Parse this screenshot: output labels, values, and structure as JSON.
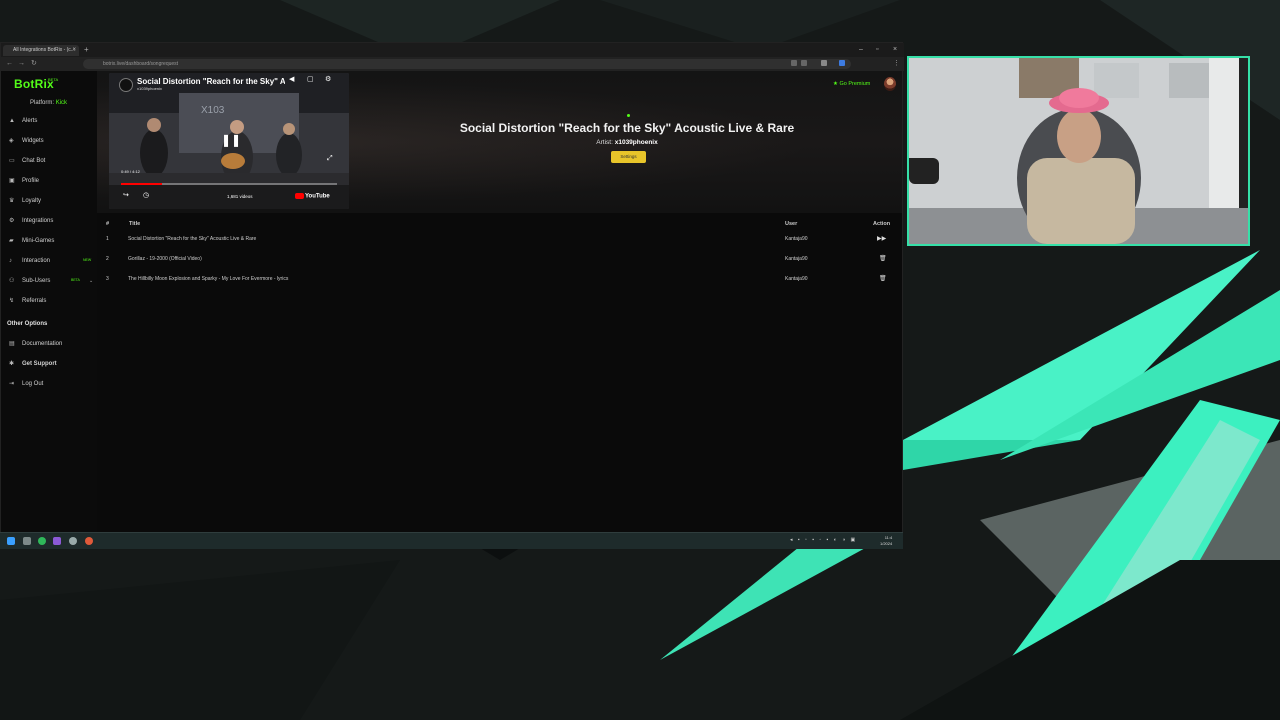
{
  "browser": {
    "tab_title": "All Integrations BotRix - (c...",
    "url": "botrix.live/dashboard/songrequest"
  },
  "sidebar": {
    "logo": "BotRix",
    "logo_beta": "BETA",
    "platform_label": "Platform:",
    "platform_value": "Kick",
    "items": [
      {
        "label": "Alerts",
        "icon": "bell-icon"
      },
      {
        "label": "Widgets",
        "icon": "widget-icon"
      },
      {
        "label": "Chat Bot",
        "icon": "chat-icon"
      },
      {
        "label": "Profile",
        "icon": "profile-icon"
      },
      {
        "label": "Loyalty",
        "icon": "trophy-icon"
      },
      {
        "label": "Integrations",
        "icon": "plug-icon"
      },
      {
        "label": "Mini-Games",
        "icon": "gamepad-icon"
      },
      {
        "label": "Interaction",
        "icon": "music-icon",
        "badge": "NEW"
      },
      {
        "label": "Sub-Users",
        "icon": "users-icon",
        "badge": "BETA"
      },
      {
        "label": "Referrals",
        "icon": "referral-icon"
      }
    ],
    "other_title": "Other Options",
    "other_items": [
      {
        "label": "Documentation",
        "icon": "doc-icon"
      },
      {
        "label": "Get Support",
        "icon": "support-icon"
      },
      {
        "label": "Log Out",
        "icon": "logout-icon"
      }
    ]
  },
  "header": {
    "go_premium": "Go Premium"
  },
  "player": {
    "video_title": "Social Distortion \"Reach for the Sky\" A",
    "video_channel": "x1039phoenix",
    "video_time": "0:49 / 4:12",
    "video_progress": 0.19,
    "video_views": "1,681 videos",
    "youtube_label": "YouTube",
    "now_title": "Social Distortion \"Reach for the Sky\" Acoustic Live & Rare",
    "artist_label": "Artist:",
    "artist_value": "x1039phoenix",
    "settings_label": "Settings"
  },
  "queue": {
    "headers": {
      "num": "#",
      "title": "Title",
      "user": "User",
      "action": "Action"
    },
    "rows": [
      {
        "num": "1",
        "title": "Social Distortion \"Reach for the Sky\" Acoustic Live & Rare",
        "user": "Kantaja90",
        "action": "play-next-icon"
      },
      {
        "num": "2",
        "title": "Gorillaz - 19-2000 (Official Video)",
        "user": "Kantaja90",
        "action": "trash-icon"
      },
      {
        "num": "3",
        "title": "The Hillbilly Moon Explosion and Sparky - My Love For Evermore - lyrics",
        "user": "Kantaja90",
        "action": "trash-icon"
      }
    ]
  },
  "colors": {
    "accent": "#53fc18",
    "webcam_border": "#36e0a8",
    "settings_button": "#e8c52a"
  }
}
